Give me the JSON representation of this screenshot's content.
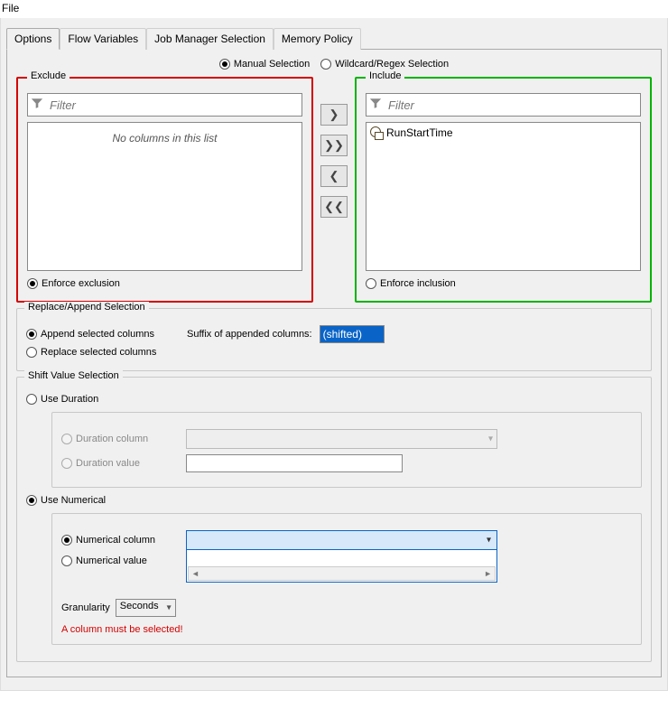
{
  "menu": {
    "file": "File"
  },
  "tabs": {
    "options": "Options",
    "flow_variables": "Flow Variables",
    "job_manager": "Job Manager Selection",
    "memory_policy": "Memory Policy"
  },
  "selection_mode": {
    "manual": "Manual Selection",
    "wildcard": "Wildcard/Regex Selection"
  },
  "exclude": {
    "legend": "Exclude",
    "filter_placeholder": "Filter",
    "empty_msg": "No columns in this list",
    "enforce": "Enforce exclusion"
  },
  "include": {
    "legend": "Include",
    "filter_placeholder": "Filter",
    "items": {
      "0": {
        "label": "RunStartTime"
      }
    },
    "enforce": "Enforce inclusion"
  },
  "transfer": {
    "right": "❯",
    "right_all": "❯❯",
    "left": "❮",
    "left_all": "❮❮"
  },
  "replace": {
    "legend": "Replace/Append Selection",
    "append": "Append selected columns",
    "replace": "Replace selected columns",
    "suffix_label": "Suffix of appended columns:",
    "suffix_value": "(shifted)"
  },
  "shift": {
    "legend": "Shift Value Selection",
    "use_duration": "Use Duration",
    "duration_column": "Duration column",
    "duration_value": "Duration value",
    "use_numerical": "Use Numerical",
    "numerical_column": "Numerical column",
    "numerical_value": "Numerical value",
    "granularity_label": "Granularity",
    "granularity_value": "Seconds",
    "error": "A column must be selected!"
  }
}
